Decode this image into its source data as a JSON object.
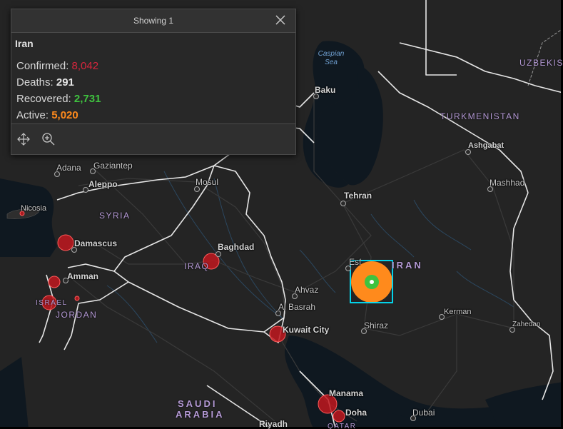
{
  "popup": {
    "header_title": "Showing 1",
    "feature_title": "Iran",
    "confirmed_label": "Confirmed: ",
    "confirmed_value": "8,042",
    "deaths_label": "Deaths: ",
    "deaths_value": "291",
    "recovered_label": "Recovered: ",
    "recovered_value": "2,731",
    "active_label": "Active: ",
    "active_value": "5,020",
    "colors": {
      "confirmed": "#d7263d",
      "recovered": "#3fc23f",
      "active": "#ff8a1c"
    },
    "icons": {
      "close": "close-icon",
      "pan": "pan-icon",
      "zoom": "zoom-in-icon"
    }
  },
  "map": {
    "countries": [
      "UZBEKIS",
      "TURKMENISTAN",
      "SYRIA",
      "IRAQ",
      "ISRAEL",
      "JORDAN",
      "IRAN",
      "SAUDI",
      "ARABIA",
      "QATAR"
    ],
    "seas": {
      "caspian_line1": "Caspian",
      "caspian_line2": "Sea"
    },
    "cities": [
      "Baku",
      "Adana",
      "Gaziantep",
      "Aleppo",
      "Mosul",
      "Nicosia",
      "Damascus",
      "Amman",
      "Baghdad",
      "Tehran",
      "Ashgabat",
      "Mashhad",
      "Esfahan",
      "Ahvaz",
      "Al Basrah",
      "Kuwait City",
      "Shiraz",
      "Kerman",
      "Zahedan",
      "Manama",
      "Doha",
      "Dubai",
      "Riyadh"
    ],
    "colors": {
      "land": "#242424",
      "water": "#0f1820",
      "border": "#ffffff",
      "road": "#3c3c3c",
      "river": "#2c4b66",
      "case": "#c0181f",
      "selection": "#00e5ff"
    }
  }
}
